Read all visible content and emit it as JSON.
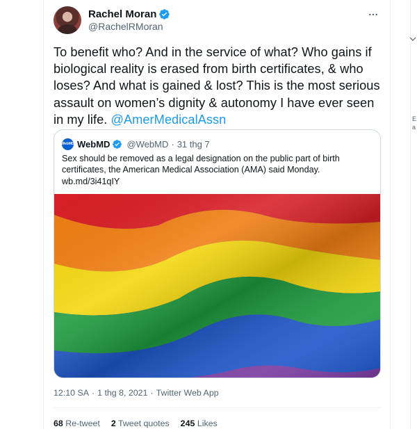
{
  "tweet": {
    "author_name": "Rachel Moran",
    "author_handle": "@RachelRMoran",
    "text": "To benefit who? And in the service of what? Who gains if biological reality is erased from birth certificates, & who loses? And what is gained & lost? This is the most serious assault on women’s dignity & autonomy I have ever seen in my life. ",
    "mention": "@AmerMedicalAssn",
    "time": "12:10 SA",
    "date": "1 thg 8, 2021",
    "source": "Twitter Web App",
    "icons": {
      "verified": "verified-badge-icon",
      "more": "more-dots-icon"
    },
    "colors": {
      "accent": "#1d9bf0",
      "secondary_text": "#536471",
      "border": "#cfd9de"
    }
  },
  "quote": {
    "avatar_text": "WebMD",
    "author_name": "WebMD",
    "author_handle": "@WebMD",
    "dot": "·",
    "date": "31 thg 7",
    "text": "Sex should be removed as a legal designation on the public part of birth certificates, the American Medical Association (AMA) said Monday.",
    "link": "wb.md/3i41qIY",
    "image": "rainbow-pride-flag"
  },
  "stats": {
    "retweets_count": "68",
    "retweets_label": "Re-tweet",
    "quotes_count": "2",
    "quotes_label": "Tweet quotes",
    "likes_count": "245",
    "likes_label": "Likes"
  },
  "right_panel": {
    "fragment_1": "E",
    "fragment_2": "a"
  }
}
